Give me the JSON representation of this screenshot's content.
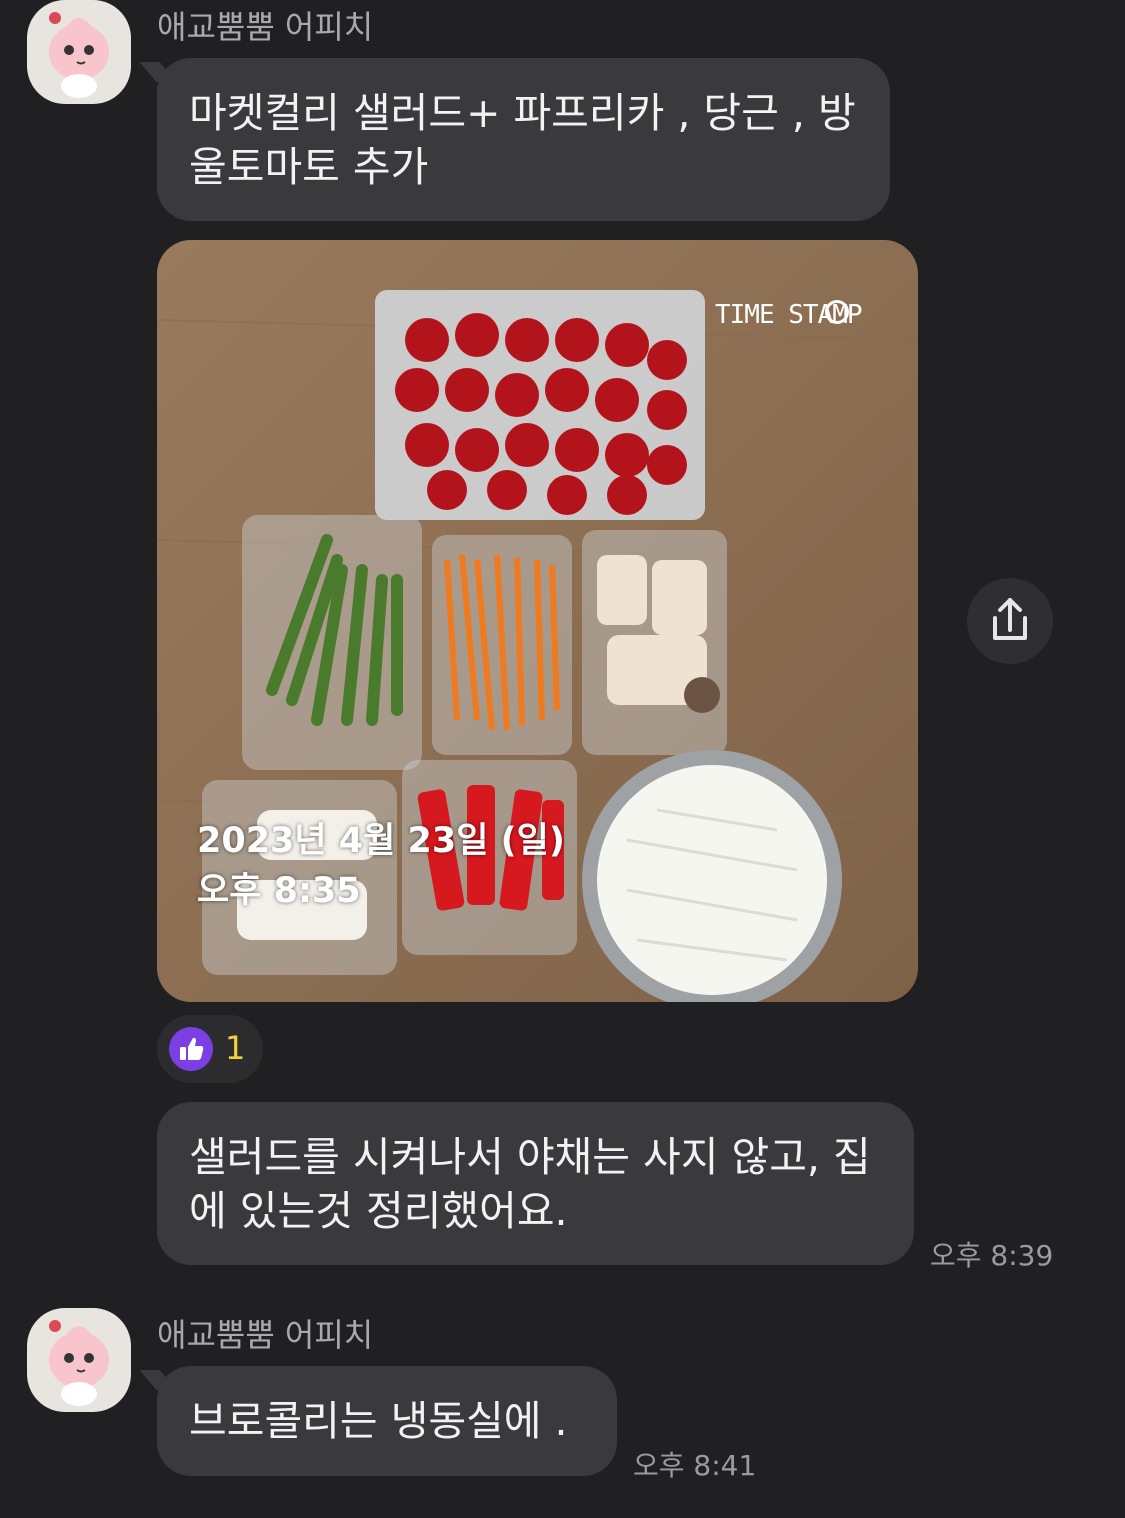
{
  "messages": [
    {
      "sender": "애교뿜뿜 어피치",
      "text_line1": "마켓컬리 샐러드+ 파프리카 , 당근 , 방",
      "text_line2": "울토마토 추가"
    },
    {
      "text_line1": "샐러드를 시켜나서 야채는 사지 않고, 집",
      "text_line2": "에 있는것 정리했어요.",
      "time": "오후 8:39"
    },
    {
      "sender": "애교뿜뿜 어피치",
      "text": "브로콜리는 냉동실에 .",
      "time": "오후 8:41"
    }
  ],
  "photo": {
    "stamp_brand": "TIME STAMP",
    "stamp_date": "2023년 4월 23일 (일)",
    "stamp_time": "오후 8:35"
  },
  "reaction": {
    "icon": "thumbs-up-icon",
    "count": "1"
  },
  "share": {
    "icon": "share-icon"
  }
}
